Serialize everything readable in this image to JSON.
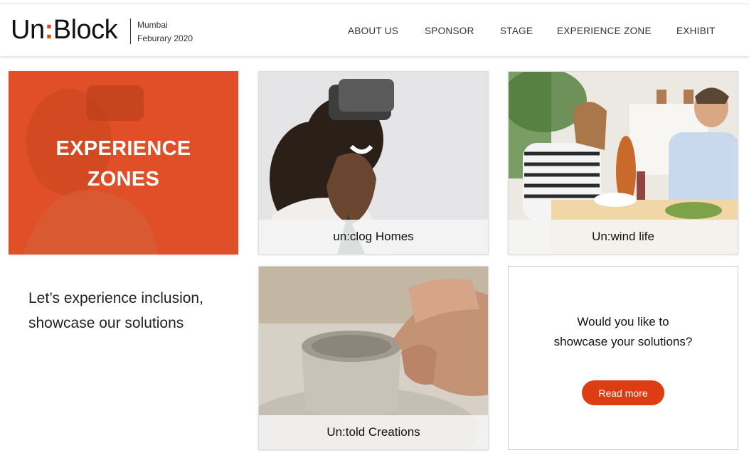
{
  "brand": {
    "name_left": "Un",
    "name_colon": ":",
    "name_right": "Block"
  },
  "event": {
    "city": "Mumbai",
    "date": "Feburary 2020"
  },
  "nav": {
    "items": [
      {
        "label": "ABOUT US"
      },
      {
        "label": "SPONSOR"
      },
      {
        "label": "STAGE"
      },
      {
        "label": "EXPERIENCE ZONE"
      },
      {
        "label": "EXHIBIT"
      }
    ]
  },
  "hero": {
    "title_line1": "EXPERIENCE",
    "title_line2": "ZONES"
  },
  "tagline": "Let’s experience inclusion, showcase our solutions",
  "cards": [
    {
      "label": "un:clog Homes",
      "image": "woman-vr-headset-photo"
    },
    {
      "label": "Un:wind life",
      "image": "couple-dining-photo"
    },
    {
      "label": "Un:told Creations",
      "image": "pottery-wheel-photo"
    }
  ],
  "cta": {
    "line1": "Would you like to",
    "line2": "showcase your solutions?",
    "button_label": "Read more"
  },
  "colors": {
    "accent": "#e04f27",
    "button": "#dc3d13"
  }
}
